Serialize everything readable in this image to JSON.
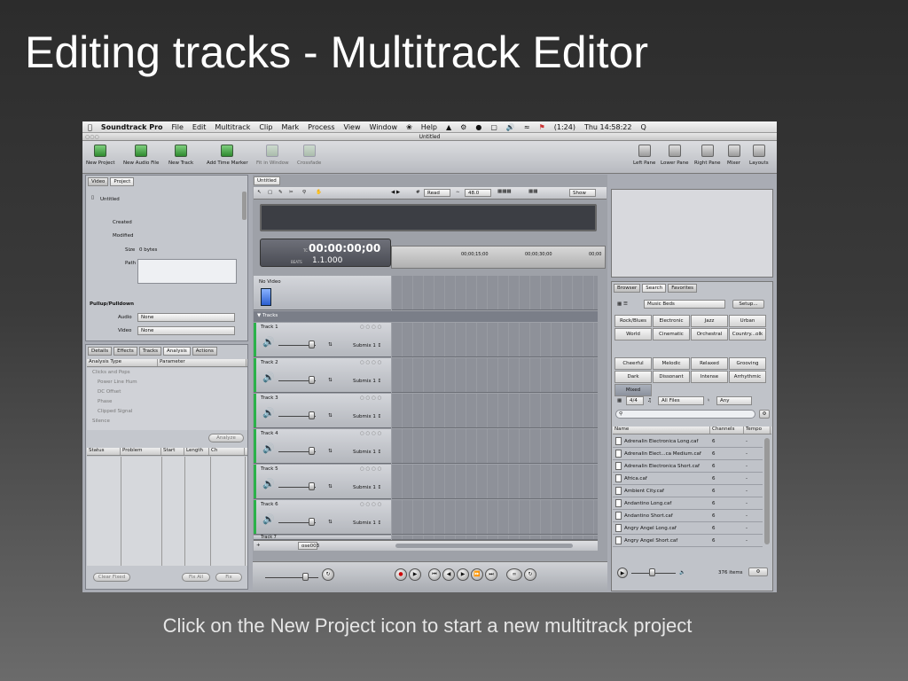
{
  "slide": {
    "title": "Editing tracks - Multitrack Editor",
    "caption": "Click on the New Project icon to start a new multitrack project"
  },
  "menubar": {
    "apple": "",
    "app": "Soundtrack Pro",
    "items": [
      "File",
      "Edit",
      "Multitrack",
      "Clip",
      "Mark",
      "Process",
      "View",
      "Window",
      "",
      "Help"
    ],
    "battery": "(1:24)",
    "clock": "Thu 14:58:22",
    "search_icon": "Q"
  },
  "window": {
    "title": "Untitled"
  },
  "toolbar": {
    "left": [
      "New Project",
      "New Audio File",
      "New Track",
      "Add Time Marker",
      "Fit in Window",
      "Crossfade"
    ],
    "right": [
      "Left Pane",
      "Lower Pane",
      "Right Pane",
      "Mixer",
      "Layouts"
    ]
  },
  "left_panel": {
    "tabs": [
      "Video",
      "Project"
    ],
    "project_name": "Untitled",
    "created_label": "Created",
    "modified_label": "Modified",
    "size_label": "Size",
    "size_value": "0 bytes",
    "path_label": "Path",
    "pullup_label": "Pullup/Pulldown",
    "audio_label": "Audio",
    "audio_value": "None",
    "video_label": "Video",
    "video_value": "None"
  },
  "lower_panel": {
    "tabs": [
      "Details",
      "Effects",
      "Tracks",
      "Analysis",
      "Actions"
    ],
    "col1": "Analysis Type",
    "col2": "Parameter",
    "analysis_items": [
      "Clicks and Pops",
      "Power Line Hum",
      "DC Offset",
      "Phase",
      "Clipped Signal",
      "Silence"
    ],
    "analyze_button": "Analyze",
    "table_cols": [
      "Status",
      "Problem",
      "Start",
      "Length",
      "Ch"
    ],
    "buttons": [
      "Clear Fixed",
      "Fix All",
      "Fix"
    ]
  },
  "editor": {
    "tab": "Untitled",
    "mode_select": "Read",
    "zoom_value": "48.0",
    "show_select": "Show",
    "timecode": "00:00:00;00",
    "timecode_prefix": "TC",
    "beats": "1.1.000",
    "beats_prefix": "BEATS",
    "ruler_marks": [
      "00;00;15;00",
      "00;00;30;00",
      "00;00"
    ],
    "video_track": "No Video",
    "tracks_label": "Tracks",
    "tracks": [
      {
        "name": "Track 1",
        "output": "Submix 1 ↕"
      },
      {
        "name": "Track 2",
        "output": "Submix 1 ↕"
      },
      {
        "name": "Track 3",
        "output": "Submix 1 ↕"
      },
      {
        "name": "Track 4",
        "output": "Submix 1 ↕"
      },
      {
        "name": "Track 5",
        "output": "Submix 1 ↕"
      },
      {
        "name": "Track 6",
        "output": "Submix 1 ↕"
      },
      {
        "name": "Track 7",
        "output": ""
      }
    ],
    "footer_select": "ose003"
  },
  "right_panel": {
    "tabs": [
      "Browser",
      "Search",
      "Favorites"
    ],
    "music_select": "Music Beds",
    "setup_button": "Setup...",
    "keywords_top": [
      "Rock/Blues",
      "Electronic",
      "Jazz",
      "Urban",
      "World",
      "Cinematic",
      "Orchestral",
      "Country...olk"
    ],
    "keywords_bottom": [
      "Cheerful",
      "Melodic",
      "Relaxed",
      "Grooving",
      "Dark",
      "Dissonant",
      "Intense",
      "Arrhythmic",
      "Mixed"
    ],
    "time_select": "4/4",
    "files_select": "All Files",
    "key_select": "Any",
    "file_cols": [
      "Name",
      "Channels",
      "Tempo"
    ],
    "files": [
      {
        "name": "Adrenalin Electronica Long.caf",
        "ch": "6",
        "tempo": "-"
      },
      {
        "name": "Adrenalin Elect...ca Medium.caf",
        "ch": "6",
        "tempo": "-"
      },
      {
        "name": "Adrenalin Electronica Short.caf",
        "ch": "6",
        "tempo": "-"
      },
      {
        "name": "Africa.caf",
        "ch": "6",
        "tempo": "-"
      },
      {
        "name": "Ambient City.caf",
        "ch": "6",
        "tempo": "-"
      },
      {
        "name": "Andantino Long.caf",
        "ch": "6",
        "tempo": "-"
      },
      {
        "name": "Andantino Short.caf",
        "ch": "6",
        "tempo": "-"
      },
      {
        "name": "Angry Angel Long.caf",
        "ch": "6",
        "tempo": "-"
      },
      {
        "name": "Angry Angel Short.caf",
        "ch": "6",
        "tempo": "-"
      }
    ],
    "items_count": "376 items"
  }
}
